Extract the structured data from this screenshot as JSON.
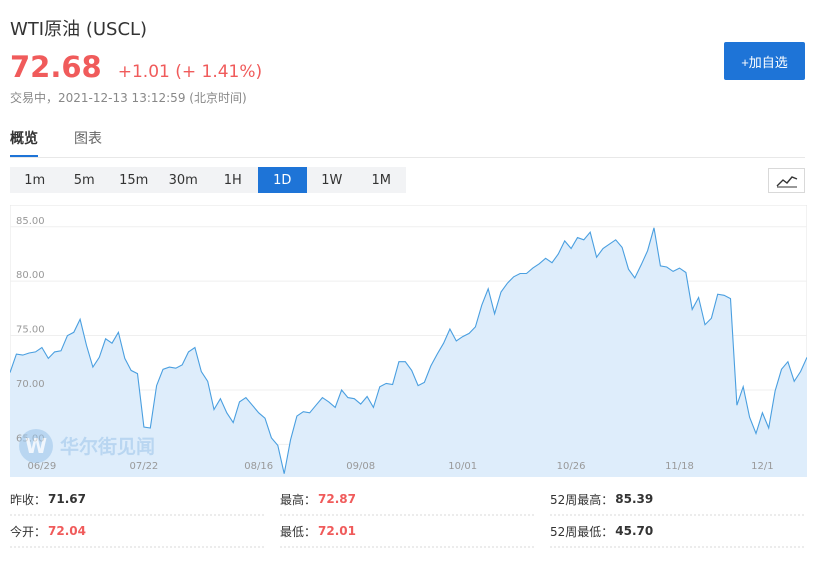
{
  "header": {
    "title": "WTI原油 (USCL)",
    "price": "72.68",
    "change": "+1.01 (+ 1.41%)",
    "status": "交易中，2021-12-13 13:12:59 (北京时间)",
    "add_button": "+加自选"
  },
  "tabs": [
    {
      "label": "概览",
      "active": true
    },
    {
      "label": "图表",
      "active": false
    }
  ],
  "periods": [
    {
      "label": "1m",
      "active": false
    },
    {
      "label": "5m",
      "active": false
    },
    {
      "label": "15m",
      "active": false
    },
    {
      "label": "30m",
      "active": false
    },
    {
      "label": "1H",
      "active": false
    },
    {
      "label": "1D",
      "active": true
    },
    {
      "label": "1W",
      "active": false
    },
    {
      "label": "1M",
      "active": false
    }
  ],
  "chart_type_icon": "line-chart-icon",
  "watermark": "华尔街见闻",
  "colors": {
    "accent": "#1e74d7",
    "up": "#f05b5b",
    "line": "#4a9fe0",
    "fill": "#deedfb"
  },
  "chart_data": {
    "type": "area",
    "ylim": [
      62,
      87
    ],
    "y_ticks": [
      65,
      70,
      75,
      80,
      85
    ],
    "y_tick_labels": [
      "65.00",
      "70.00",
      "75.00",
      "80.00",
      "85.00"
    ],
    "x_tick_labels": [
      "06/29",
      "07/22",
      "08/16",
      "09/08",
      "10/01",
      "10/26",
      "11/18",
      "12/1"
    ],
    "x_tick_index": [
      5,
      21,
      39,
      55,
      71,
      88,
      105,
      118
    ],
    "grid": true,
    "values": [
      71.6,
      73.3,
      73.2,
      73.4,
      73.5,
      73.9,
      72.9,
      73.5,
      73.6,
      75.0,
      75.3,
      76.5,
      74.1,
      72.1,
      73.0,
      74.7,
      74.3,
      75.3,
      72.9,
      71.8,
      71.5,
      66.6,
      66.5,
      70.4,
      71.9,
      72.1,
      72.0,
      72.3,
      73.5,
      73.9,
      71.7,
      70.8,
      68.2,
      69.2,
      67.9,
      67.0,
      68.9,
      69.3,
      68.6,
      67.9,
      67.4,
      65.6,
      64.9,
      62.3,
      65.4,
      67.6,
      68.0,
      67.9,
      68.6,
      69.3,
      68.9,
      68.4,
      70.0,
      69.3,
      69.2,
      68.7,
      69.4,
      68.4,
      70.3,
      70.6,
      70.5,
      72.6,
      72.6,
      71.8,
      70.4,
      70.7,
      72.2,
      73.3,
      74.3,
      75.6,
      74.5,
      74.9,
      75.2,
      75.8,
      77.8,
      79.3,
      77.0,
      79.0,
      79.8,
      80.4,
      80.7,
      80.7,
      81.2,
      81.6,
      82.1,
      81.7,
      82.5,
      83.7,
      83.0,
      84.0,
      83.8,
      84.5,
      82.2,
      83.0,
      83.4,
      83.8,
      83.1,
      81.1,
      80.3,
      81.5,
      82.8,
      84.9,
      81.4,
      81.3,
      80.9,
      81.2,
      80.8,
      77.4,
      78.5,
      76.0,
      76.6,
      78.8,
      78.7,
      78.4,
      68.6,
      70.3,
      67.5,
      66.0,
      67.9,
      66.5,
      69.9,
      71.9,
      72.6,
      70.8,
      71.7,
      73.0
    ]
  },
  "stats": {
    "row1": [
      {
        "label": "昨收：",
        "value": "71.67",
        "tone": "dark"
      },
      {
        "label": "最高：",
        "value": "72.87",
        "tone": "up"
      },
      {
        "label": "52周最高：",
        "value": "85.39",
        "tone": "dark"
      }
    ],
    "row2": [
      {
        "label": "今开：",
        "value": "72.04",
        "tone": "up"
      },
      {
        "label": "最低：",
        "value": "72.01",
        "tone": "up"
      },
      {
        "label": "52周最低：",
        "value": "45.70",
        "tone": "dark"
      }
    ]
  }
}
